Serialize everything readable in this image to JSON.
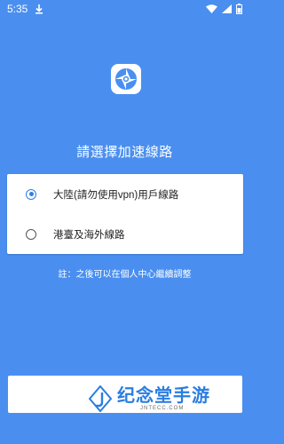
{
  "status_bar": {
    "time": "5:35",
    "icons": [
      "download-icon",
      "wifi-icon",
      "signal-icon",
      "battery-icon"
    ]
  },
  "app": {
    "logo_icon": "camera-aperture-icon",
    "accent_color": "#2f7fe6",
    "background_color": "#4a8ff0"
  },
  "prompt": {
    "title": "請選擇加速線路",
    "options": [
      {
        "label": "大陸(請勿使用vpn)用戶線路",
        "selected": true
      },
      {
        "label": "港臺及海外線路",
        "selected": false
      }
    ],
    "note": "註：之後可以在個人中心繼續調整"
  },
  "bottom_button": {
    "label": ""
  },
  "watermark": {
    "title": "纪念堂手游",
    "subtitle": "JNTECC.COM"
  }
}
